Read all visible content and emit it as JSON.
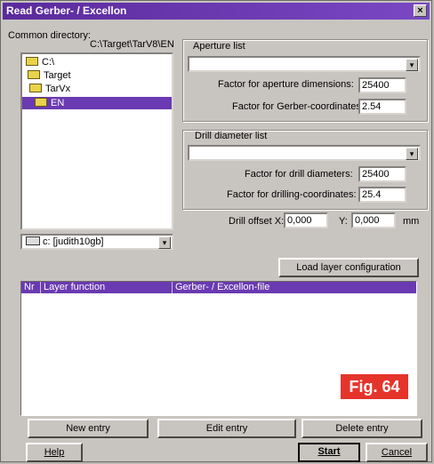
{
  "window": {
    "title": "Read Gerber- / Excellon",
    "close_glyph": "×"
  },
  "directory": {
    "label": "Common directory:",
    "path": "C:\\Target\\TarV8\\EN",
    "tree": [
      "C:\\",
      "Target",
      "TarVx",
      "EN"
    ],
    "selected_index": 3
  },
  "drive": {
    "value": "c: [judith10gb]",
    "arrow": "▾"
  },
  "aperture": {
    "group_label": "Aperture list",
    "list_value": "",
    "arrow": "▾",
    "dim_label": "Factor for aperture dimensions:",
    "dim_value": "25400",
    "coord_label": "Factor for Gerber-coordinates:",
    "coord_value": "2.54"
  },
  "drill": {
    "group_label": "Drill diameter list",
    "list_value": "",
    "arrow": "▾",
    "dia_label": "Factor for drill diameters:",
    "dia_value": "25400",
    "coord_label": "Factor for drilling-coordinates:",
    "coord_value": "25.4",
    "offset_x_label": "Drill offset X:",
    "offset_x_value": "0,000",
    "offset_y_label": "Y:",
    "offset_y_value": "0,000",
    "unit": "mm"
  },
  "load_config_label": "Load layer configuration",
  "table": {
    "columns": [
      "Nr",
      "Layer function",
      "Gerber- / Excellon-file"
    ],
    "rows": []
  },
  "buttons": {
    "new_entry": "New entry",
    "edit_entry": "Edit entry",
    "delete_entry": "Delete entry",
    "help": "Help",
    "start": "Start",
    "cancel": "Cancel"
  },
  "figure_label": "Fig. 64",
  "colors": {
    "title_bar": "#6a3ab2",
    "selection": "#6a3ab2",
    "badge": "#e5342c"
  }
}
